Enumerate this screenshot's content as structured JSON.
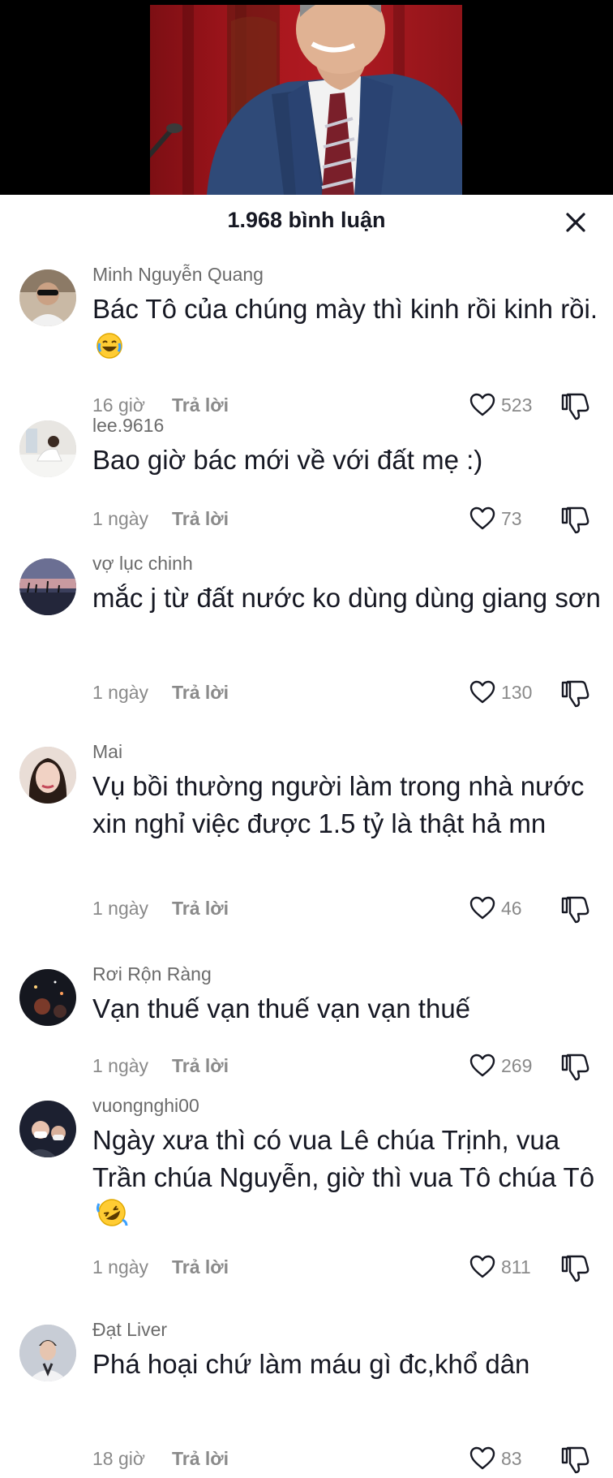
{
  "header": {
    "title": "1.968 bình luận"
  },
  "comments": [
    {
      "username": "Minh Nguyễn Quang",
      "text": "Bác Tô của chúng mày thì kinh rồi kinh rồi.",
      "emoji": "laughing-emoji",
      "time": "16 giờ",
      "reply_label": "Trả lời",
      "likes": "523"
    },
    {
      "username": "lee.9616",
      "text": "Bao giờ bác mới về với đất mẹ :)",
      "time": "1 ngày",
      "reply_label": "Trả lời",
      "likes": "73"
    },
    {
      "username": "vợ lục chinh",
      "text": "mắc j từ đất nước ko dùng dùng giang sơn",
      "time": "1 ngày",
      "reply_label": "Trả lời",
      "likes": "130"
    },
    {
      "username": "Mai",
      "text": "Vụ bồi thường người làm trong nhà nước xin nghỉ việc được 1.5 tỷ là thật hả mn",
      "time": "1 ngày",
      "reply_label": "Trả lời",
      "likes": "46"
    },
    {
      "username": "Rơi Rộn Ràng",
      "text": "Vạn thuế vạn thuế vạn vạn thuế",
      "time": "1 ngày",
      "reply_label": "Trả lời",
      "likes": "269"
    },
    {
      "username": "vuongnghi00",
      "text": "Ngày xưa thì có vua Lê chúa Trịnh, vua Trần chúa Nguyễn, giờ thì vua Tô chúa Tô",
      "emoji": "rofl-emoji",
      "time": "1 ngày",
      "reply_label": "Trả lời",
      "likes": "811"
    },
    {
      "username": "Đạt Liver",
      "text": "Phá hoại chứ làm máu gì đc,khổ dân",
      "time": "18 giờ",
      "reply_label": "Trả lời",
      "likes": "83"
    }
  ]
}
